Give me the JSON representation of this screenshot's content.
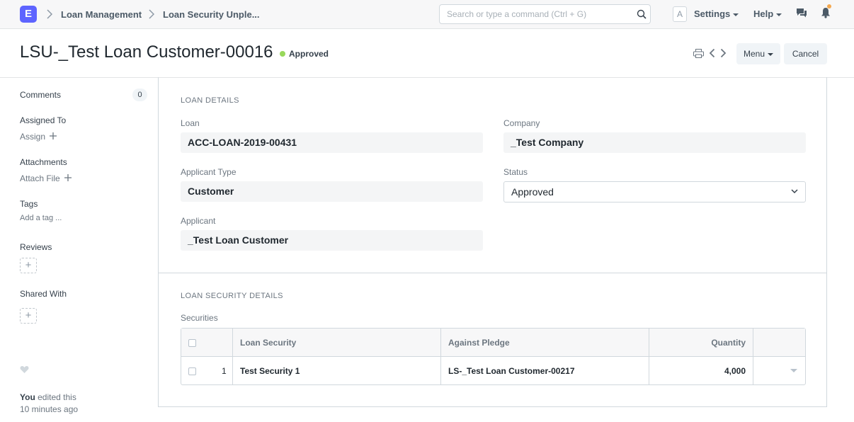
{
  "navbar": {
    "logo_letter": "E",
    "breadcrumbs": [
      "Loan Management",
      "Loan Security Unple..."
    ],
    "search_placeholder": "Search or type a command (Ctrl + G)",
    "avatar_letter": "A",
    "settings_label": "Settings",
    "help_label": "Help",
    "notification_dot_color": "#f4a84f"
  },
  "page": {
    "title": "LSU-_Test Loan Customer-00016",
    "status": "Approved",
    "status_color": "#98d85b",
    "menu_label": "Menu",
    "cancel_label": "Cancel"
  },
  "sidebar": {
    "comments_label": "Comments",
    "comments_count": "0",
    "assigned_to_label": "Assigned To",
    "assign_label": "Assign",
    "attachments_label": "Attachments",
    "attach_file_label": "Attach File",
    "tags_label": "Tags",
    "add_tag_label": "Add a tag ...",
    "reviews_label": "Reviews",
    "shared_with_label": "Shared With",
    "editor_name": "You",
    "edited_text": "edited this",
    "edited_time": "10 minutes ago"
  },
  "loan_details": {
    "section_title": "LOAN DETAILS",
    "loan_label": "Loan",
    "loan_value": "ACC-LOAN-2019-00431",
    "company_label": "Company",
    "company_value": "_Test Company",
    "applicant_type_label": "Applicant Type",
    "applicant_type_value": "Customer",
    "status_label": "Status",
    "status_value": "Approved",
    "applicant_label": "Applicant",
    "applicant_value": "_Test Loan Customer"
  },
  "security_details": {
    "section_title": "LOAN SECURITY DETAILS",
    "table_label": "Securities",
    "columns": [
      "Loan Security",
      "Against Pledge",
      "Quantity"
    ],
    "rows": [
      {
        "idx": "1",
        "loan_security": "Test Security 1",
        "against_pledge": "LS-_Test Loan Customer-00217",
        "quantity": "4,000"
      }
    ]
  }
}
